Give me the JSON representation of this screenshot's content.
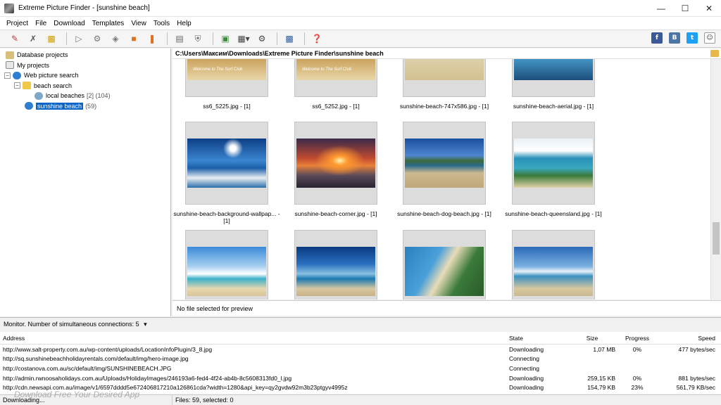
{
  "window": {
    "title": "Extreme Picture Finder - [sunshine beach]"
  },
  "menu": [
    "Project",
    "File",
    "Download",
    "Templates",
    "View",
    "Tools",
    "Help"
  ],
  "tree": {
    "items": [
      {
        "label": "Database projects"
      },
      {
        "label": "My projects"
      },
      {
        "label": "Web picture search"
      },
      {
        "label": "beach search"
      },
      {
        "label": "local beaches",
        "count": "[2] (104)"
      },
      {
        "label": "sunshine beach",
        "count": "(59)"
      }
    ]
  },
  "path": "C:\\Users\\Максим\\Downloads\\Extreme Picture Finder\\sunshine beach",
  "thumbnails": [
    {
      "caption": "ss6_5225.jpg - [1]"
    },
    {
      "caption": "ss6_5252.jpg - [1]"
    },
    {
      "caption": "sunshine-beach-747x586.jpg - [1]"
    },
    {
      "caption": "sunshine-beach-aerial.jpg - [1]"
    },
    {
      "caption": "sunshine-beach-background-wallpap... - [1]"
    },
    {
      "caption": "sunshine-beach-corner.jpg - [1]"
    },
    {
      "caption": "sunshine-beach-dog-beach.jpg - [1]"
    },
    {
      "caption": "sunshine-beach-queensland.jpg - [1]"
    },
    {
      "caption": ""
    },
    {
      "caption": ""
    },
    {
      "caption": ""
    },
    {
      "caption": ""
    }
  ],
  "banner_text": "Welcome to The Surf Club",
  "preview": "No file selected for preview",
  "monitor": "Monitor. Number of simultaneous connections: 5",
  "downloads": {
    "headers": {
      "address": "Address",
      "state": "State",
      "size": "Size",
      "progress": "Progress",
      "speed": "Speed"
    },
    "rows": [
      {
        "address": "http://www.salt-property.com.au/wp-content/uploads/LocationInfoPlugin/3_8.jpg",
        "state": "Downloading",
        "size": "1,07 MB",
        "progress": "0%",
        "speed": "477 bytes/sec"
      },
      {
        "address": "http://sq.sunshinebeachholidayrentals.com/default/img/hero-image.jpg",
        "state": "Connecting",
        "size": "",
        "progress": "",
        "speed": ""
      },
      {
        "address": "http://costanova.com.au/sc/default/img/SUNSHINEBEACH.JPG",
        "state": "Connecting",
        "size": "",
        "progress": "",
        "speed": ""
      },
      {
        "address": "http://admin.rwnoosaholidays.com.au/Uploads/HolidayImages/246193a6-fed4-4f24-ab4b-8c5608313fd0_l.jpg",
        "state": "Downloading",
        "size": "259,15 KB",
        "progress": "0%",
        "speed": "881 bytes/sec"
      },
      {
        "address": "http://cdn.newsapi.com.au/image/v1/6597dddd5e672406817210a126861cda?width=1280&api_key=qy2gvdw92m3b23ptgyv4995z",
        "state": "Downloading",
        "size": "154,79 KB",
        "progress": "23%",
        "speed": "561,79 KB/sec"
      }
    ]
  },
  "status": {
    "left": "Downloading...",
    "right": "Files: 59, selected: 0"
  },
  "watermark": "Download Free Your Desired App",
  "colors": {
    "selection": "#0a64c8"
  }
}
